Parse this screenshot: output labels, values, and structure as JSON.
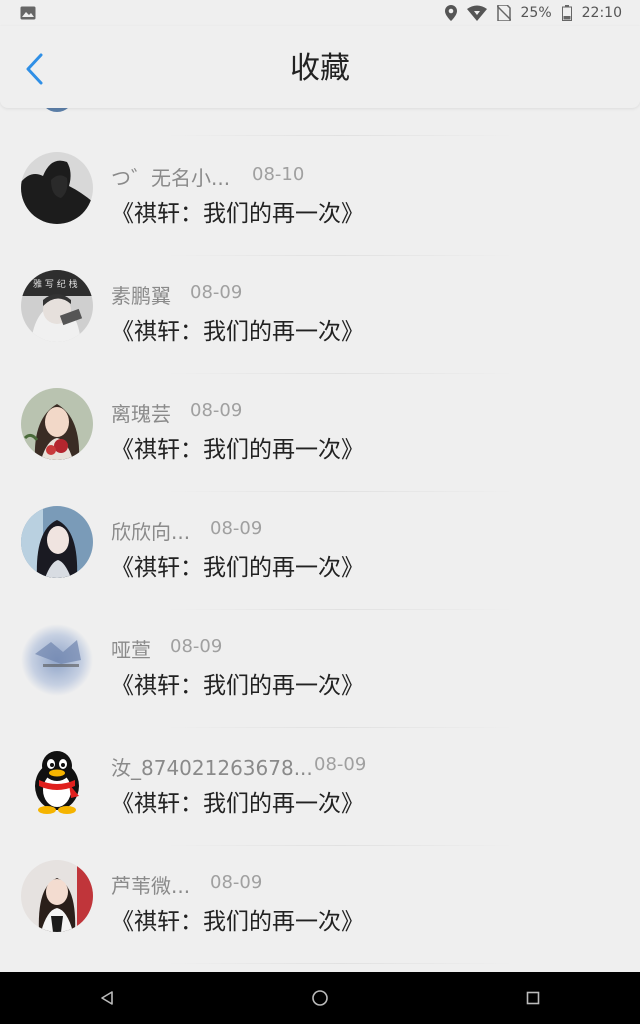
{
  "status_bar": {
    "battery": "25%",
    "time": "22:10",
    "icons": [
      "image-icon",
      "location-icon",
      "wifi-icon",
      "no-sim-icon",
      "battery-icon"
    ]
  },
  "header": {
    "title": "收藏",
    "back_icon": "chevron-left-icon",
    "accent_color": "#2f8fe6"
  },
  "items": [
    {
      "name": "つ゛无名小...",
      "date": "08-10",
      "title": "《祺轩：我们的再一次》"
    },
    {
      "name": "素鹏翼",
      "date": "08-09",
      "title": "《祺轩：我们的再一次》"
    },
    {
      "name": "离瑰芸",
      "date": "08-09",
      "title": "《祺轩：我们的再一次》"
    },
    {
      "name": "欣欣向...",
      "date": "08-09",
      "title": "《祺轩：我们的再一次》"
    },
    {
      "name": "哑萱",
      "date": "08-09",
      "title": "《祺轩：我们的再一次》"
    },
    {
      "name": "汝_874021263678...",
      "date": "08-09",
      "title": "《祺轩：我们的再一次》"
    },
    {
      "name": "芦苇微...",
      "date": "08-09",
      "title": "《祺轩：我们的再一次》"
    }
  ],
  "nav_bar": {
    "icons": [
      "back-triangle-icon",
      "home-circle-icon",
      "recents-square-icon"
    ]
  }
}
